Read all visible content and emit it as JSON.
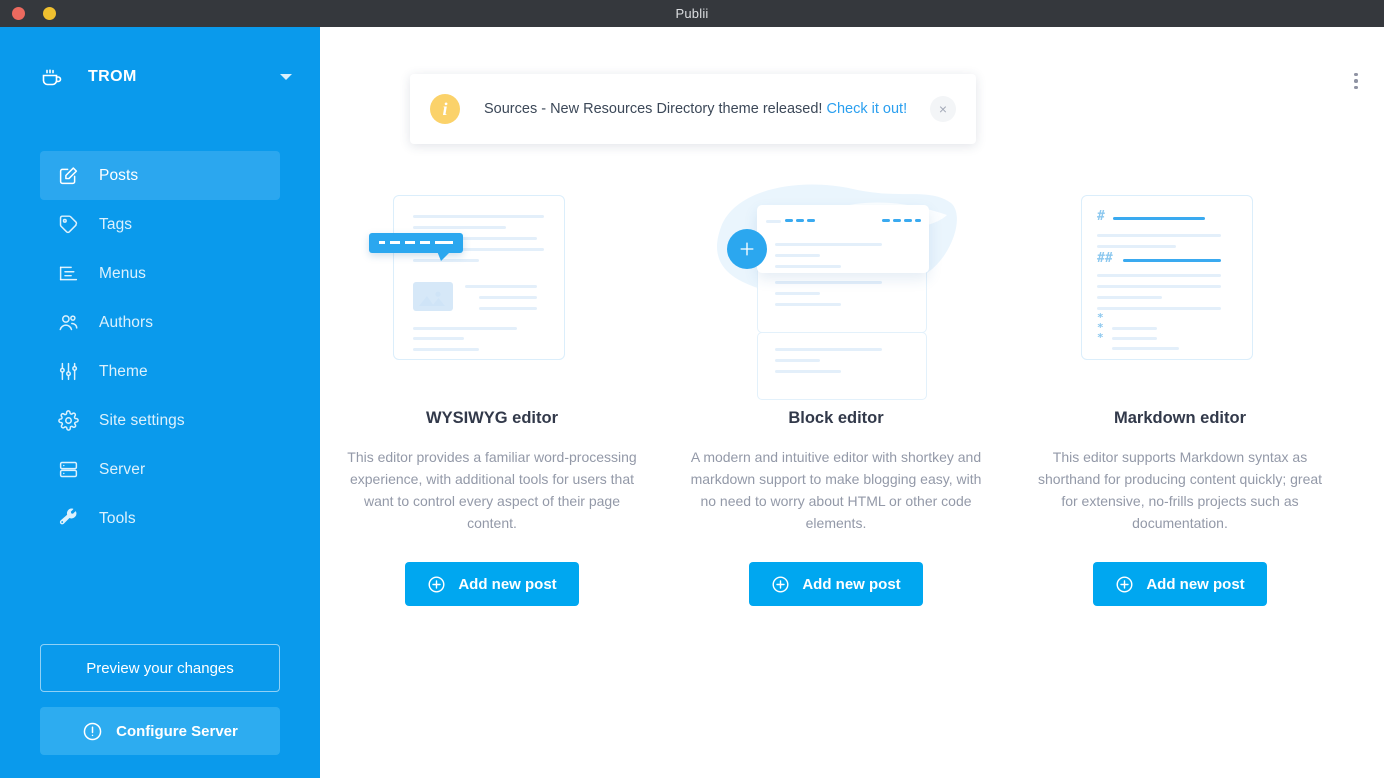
{
  "window": {
    "title": "Publii",
    "controls": [
      "close",
      "minimize"
    ]
  },
  "colors": {
    "sidebar": "#0a9aec",
    "sidebar_active": "#2ba7ef",
    "accent": "#00a7f0",
    "link": "#2a9fef",
    "info_badge": "#fbd26a",
    "titlebar": "#35383d",
    "heading_text": "#32394a",
    "body_text": "#9399a8"
  },
  "sidebar": {
    "site_name": "TROM",
    "site_icon": "coffee-cup-icon",
    "dropdown_icon": "chevron-down-icon",
    "items": [
      {
        "label": "Posts",
        "icon": "edit-square-icon",
        "active": true
      },
      {
        "label": "Tags",
        "icon": "tag-icon",
        "active": false
      },
      {
        "label": "Menus",
        "icon": "menu-list-icon",
        "active": false
      },
      {
        "label": "Authors",
        "icon": "users-icon",
        "active": false
      },
      {
        "label": "Theme",
        "icon": "sliders-icon",
        "active": false
      },
      {
        "label": "Site settings",
        "icon": "gear-icon",
        "active": false
      },
      {
        "label": "Server",
        "icon": "server-icon",
        "active": false
      },
      {
        "label": "Tools",
        "icon": "wrench-icon",
        "active": false
      }
    ],
    "preview_button": "Preview your changes",
    "configure_button": "Configure Server",
    "configure_icon": "exclamation-circle-icon"
  },
  "main": {
    "overflow_menu_icon": "kebab-menu-icon",
    "notification": {
      "badge_icon": "info-icon",
      "badge_glyph": "i",
      "message": "Sources - New Resources Directory theme released!",
      "link_text": "Check it out!",
      "close_glyph": "×",
      "close_icon": "close-icon"
    },
    "cards": [
      {
        "id": "wysiwyg",
        "art": "wysiwyg-editor-illustration",
        "title": "WYSIWYG editor",
        "description": "This editor provides a familiar word-processing experience, with additional tools for users that want to control every aspect of their page content.",
        "button_label": "Add new post",
        "button_icon": "plus-circle-icon"
      },
      {
        "id": "block",
        "art": "block-editor-illustration",
        "title": "Block editor",
        "description": "A modern and intuitive editor with shortkey and markdown support to make blogging easy, with no need to worry about HTML or other code elements.",
        "button_label": "Add new post",
        "button_icon": "plus-circle-icon"
      },
      {
        "id": "markdown",
        "art": "markdown-editor-illustration",
        "title": "Markdown editor",
        "description": "This editor supports Markdown syntax as shorthand for producing content quickly; great for extensive, no-frills projects such as documentation.",
        "button_label": "Add new post",
        "button_icon": "plus-circle-icon"
      }
    ]
  }
}
